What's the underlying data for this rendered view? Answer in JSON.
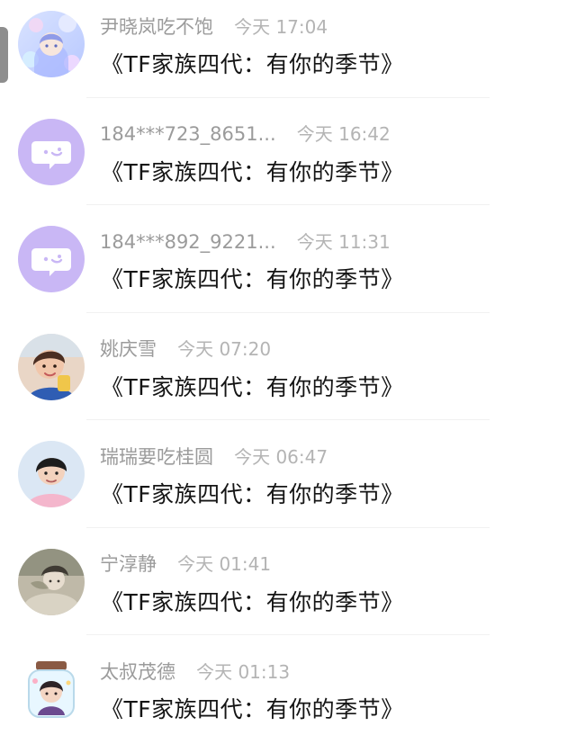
{
  "comments": [
    {
      "avatar_icon": "girl-photo-avatar-icon",
      "name": "尹晓岚吃不饱",
      "time": "今天 17:04",
      "message": "《TF家族四代：有你的季节》"
    },
    {
      "avatar_icon": "default-chat-bubble-avatar-icon",
      "name": "184***723_8651...",
      "time": "今天 16:42",
      "message": "《TF家族四代：有你的季节》"
    },
    {
      "avatar_icon": "default-chat-bubble-avatar-icon",
      "name": "184***892_9221...",
      "time": "今天 11:31",
      "message": "《TF家族四代：有你的季节》"
    },
    {
      "avatar_icon": "girl-photo-avatar-icon",
      "name": "姚庆雪",
      "time": "今天 07:20",
      "message": "《TF家族四代：有你的季节》"
    },
    {
      "avatar_icon": "boy-photo-avatar-icon",
      "name": "瑞瑞要吃桂圆",
      "time": "今天 06:47",
      "message": "《TF家族四代：有你的季节》"
    },
    {
      "avatar_icon": "vintage-photo-avatar-icon",
      "name": "宁淳静",
      "time": "今天 01:41",
      "message": "《TF家族四代：有你的季节》"
    },
    {
      "avatar_icon": "jar-illustration-avatar-icon",
      "name": "太叔茂德",
      "time": "今天 01:13",
      "message": "《TF家族四代：有你的季节》"
    }
  ],
  "colors": {
    "default_avatar_bg": "#c9b7f5",
    "name_text": "#9b9b9b",
    "time_text": "#b4b4b4",
    "message_text": "#151515"
  }
}
